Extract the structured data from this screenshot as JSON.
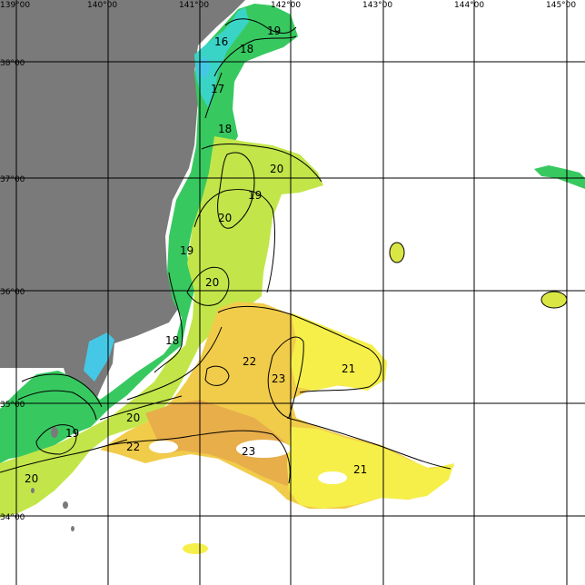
{
  "map": {
    "longitude_labels": [
      "139°00",
      "140°00",
      "141°00",
      "142°00",
      "143°00",
      "144°00",
      "145°00"
    ],
    "latitude_labels": [
      "38°00",
      "37°00",
      "36°00",
      "35°00",
      "34°00"
    ],
    "contour_labels": [
      "16",
      "19",
      "18",
      "17",
      "18",
      "20",
      "19",
      "20",
      "19",
      "20",
      "18",
      "22",
      "23",
      "21",
      "20",
      "19",
      "22",
      "23",
      "21",
      "20"
    ],
    "legend_colors": {
      "land": "#7a7a7a",
      "t16": "#45c8e6",
      "t17": "#27d3b0",
      "t18": "#3ccc52",
      "t19": "#8fdd3a",
      "t20": "#c7ea44",
      "t21": "#f6ef4a",
      "t22": "#f2d84a",
      "t23": "#eab64a"
    }
  }
}
